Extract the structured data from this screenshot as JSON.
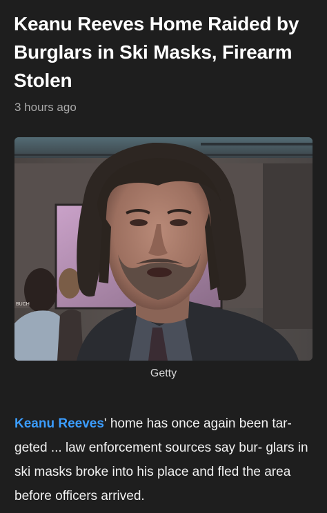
{
  "article": {
    "headline": "Keanu Reeves Home Raided by Burglars in Ski Masks, Firearm Stolen",
    "timestamp": "3 hours ago",
    "photo_credit": "Getty",
    "photo_sign_text": "BUCH",
    "body_link": "Keanu Reeves",
    "body_text": "' home has once again been tar- geted ... law enforcement sources say bur- glars in ski masks broke into his place and fled the area before officers arrived."
  },
  "colors": {
    "background": "#1e1e1e",
    "link": "#3b9dff",
    "muted": "#a9a9a9"
  }
}
